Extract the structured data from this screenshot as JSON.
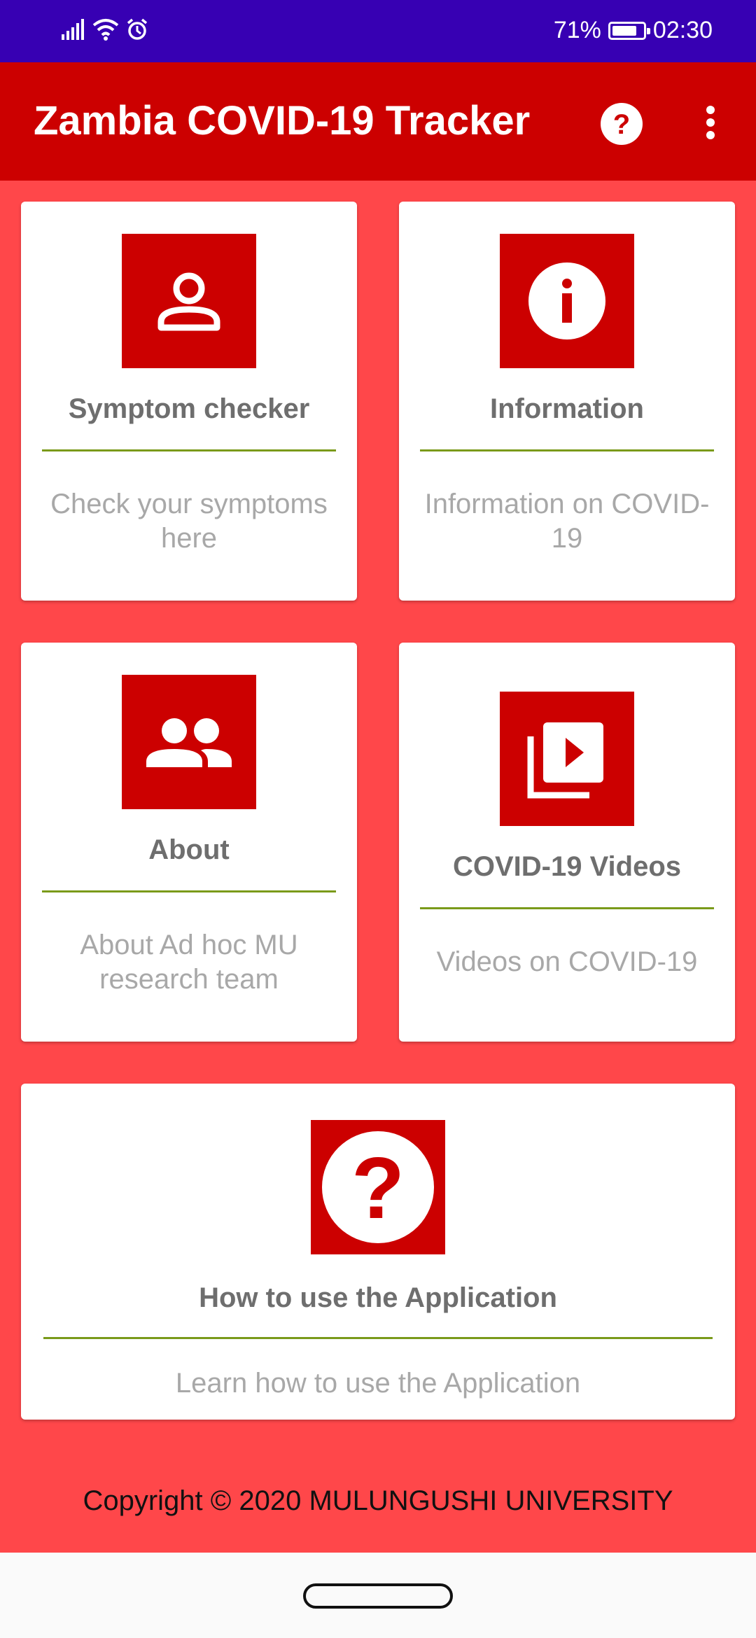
{
  "status_bar": {
    "battery_percent": "71%",
    "time": "02:30",
    "icons": [
      "signal-icon",
      "wifi-icon",
      "alarm-icon",
      "battery-charging-icon"
    ]
  },
  "app_bar": {
    "title": "Zambia COVID-19 Tracker",
    "help_icon": "help-circle-icon",
    "overflow_icon": "more-vert-icon"
  },
  "cards": [
    {
      "title": "Symptom checker",
      "description": "Check your symptoms here",
      "icon": "person-icon"
    },
    {
      "title": "Information",
      "description": "Information on COVID-19",
      "icon": "info-icon"
    },
    {
      "title": "About",
      "description": "About Ad hoc MU research team",
      "icon": "people-icon"
    },
    {
      "title": "COVID-19 Videos",
      "description": "Videos on COVID-19",
      "icon": "video-library-icon"
    },
    {
      "title": "How to use the Application",
      "description": "Learn how to use the Application",
      "icon": "help-icon"
    }
  ],
  "footer": {
    "copyright": "Copyright © 2020 MULUNGUSHI UNIVERSITY"
  },
  "colors": {
    "status_bar": "#3700b3",
    "app_bar": "#cc0000",
    "background": "#ff474a",
    "icon_box": "#cc0000",
    "divider": "#7a9a1a"
  }
}
